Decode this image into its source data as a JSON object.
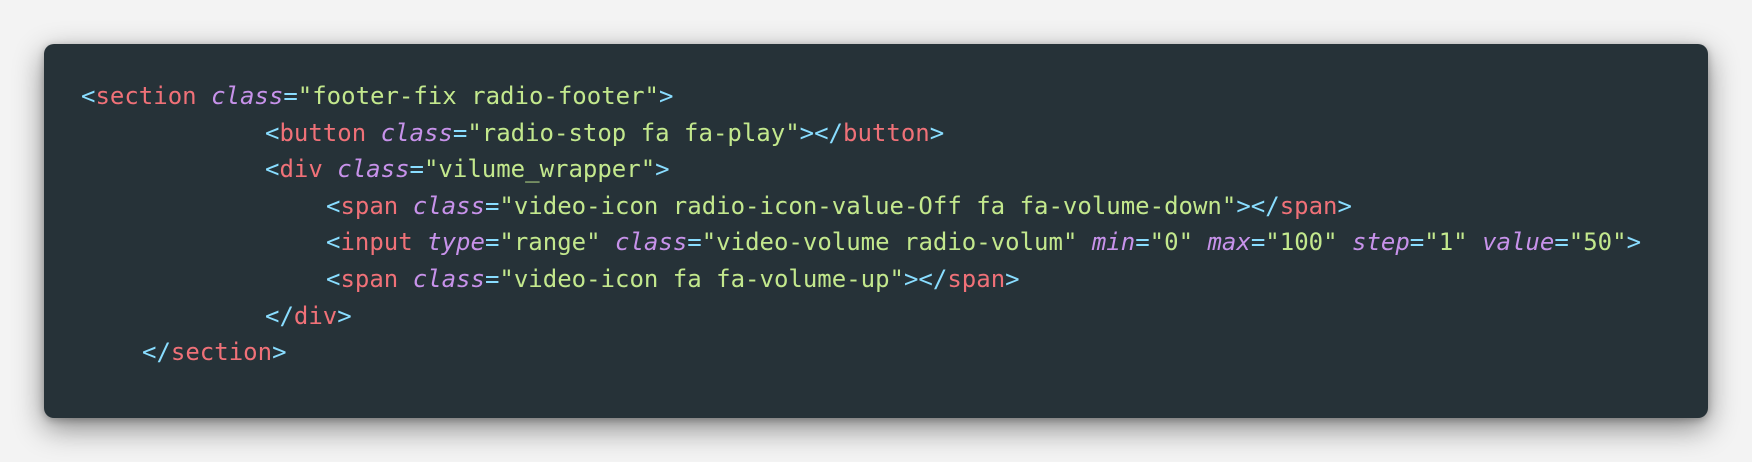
{
  "colors": {
    "background": "#f3f3f3",
    "panel": "#263238",
    "punctuation": "#89ddff",
    "tag": "#f07178",
    "attribute": "#c792ea",
    "string": "#c3e88d"
  },
  "code": {
    "lines": [
      {
        "indent": 0,
        "tokens": [
          {
            "t": "punct",
            "v": "<"
          },
          {
            "t": "tag",
            "v": "section"
          },
          {
            "t": "space",
            "v": " "
          },
          {
            "t": "attr",
            "v": "class"
          },
          {
            "t": "eq",
            "v": "="
          },
          {
            "t": "str",
            "v": "\"footer-fix radio-footer\""
          },
          {
            "t": "punct",
            "v": ">"
          }
        ]
      },
      {
        "indent": 2,
        "tokens": [
          {
            "t": "punct",
            "v": "<"
          },
          {
            "t": "tag",
            "v": "button"
          },
          {
            "t": "space",
            "v": " "
          },
          {
            "t": "attr",
            "v": "class"
          },
          {
            "t": "eq",
            "v": "="
          },
          {
            "t": "str",
            "v": "\"radio-stop fa fa-play\""
          },
          {
            "t": "punct",
            "v": "></"
          },
          {
            "t": "tag",
            "v": "button"
          },
          {
            "t": "punct",
            "v": ">"
          }
        ]
      },
      {
        "indent": 2,
        "tokens": [
          {
            "t": "punct",
            "v": "<"
          },
          {
            "t": "tag",
            "v": "div"
          },
          {
            "t": "space",
            "v": " "
          },
          {
            "t": "attr",
            "v": "class"
          },
          {
            "t": "eq",
            "v": "="
          },
          {
            "t": "str",
            "v": "\"vilume_wrapper\""
          },
          {
            "t": "punct",
            "v": ">"
          }
        ]
      },
      {
        "indent": 3,
        "tokens": [
          {
            "t": "punct",
            "v": "<"
          },
          {
            "t": "tag",
            "v": "span"
          },
          {
            "t": "space",
            "v": " "
          },
          {
            "t": "attr",
            "v": "class"
          },
          {
            "t": "eq",
            "v": "="
          },
          {
            "t": "str",
            "v": "\"video-icon radio-icon-value-Off fa fa-volume-down\""
          },
          {
            "t": "punct",
            "v": "></"
          },
          {
            "t": "tag",
            "v": "span"
          },
          {
            "t": "punct",
            "v": ">"
          }
        ]
      },
      {
        "indent": 3,
        "tokens": [
          {
            "t": "punct",
            "v": "<"
          },
          {
            "t": "tag",
            "v": "input"
          },
          {
            "t": "space",
            "v": " "
          },
          {
            "t": "attr",
            "v": "type"
          },
          {
            "t": "eq",
            "v": "="
          },
          {
            "t": "str",
            "v": "\"range\""
          },
          {
            "t": "space",
            "v": " "
          },
          {
            "t": "attr",
            "v": "class"
          },
          {
            "t": "eq",
            "v": "="
          },
          {
            "t": "str",
            "v": "\"video-volume radio-volum\""
          },
          {
            "t": "space",
            "v": " "
          },
          {
            "t": "attr",
            "v": "min"
          },
          {
            "t": "eq",
            "v": "="
          },
          {
            "t": "str",
            "v": "\"0\""
          },
          {
            "t": "space",
            "v": " "
          },
          {
            "t": "attr",
            "v": "max"
          },
          {
            "t": "eq",
            "v": "="
          },
          {
            "t": "str",
            "v": "\"100\""
          },
          {
            "t": "space",
            "v": " "
          },
          {
            "t": "attr",
            "v": "step"
          },
          {
            "t": "eq",
            "v": "="
          },
          {
            "t": "str",
            "v": "\"1\""
          },
          {
            "t": "space",
            "v": " "
          },
          {
            "t": "attr",
            "v": "value"
          },
          {
            "t": "eq",
            "v": "="
          },
          {
            "t": "str",
            "v": "\"50\""
          },
          {
            "t": "punct",
            "v": ">"
          }
        ]
      },
      {
        "indent": 3,
        "tokens": [
          {
            "t": "punct",
            "v": "<"
          },
          {
            "t": "tag",
            "v": "span"
          },
          {
            "t": "space",
            "v": " "
          },
          {
            "t": "attr",
            "v": "class"
          },
          {
            "t": "eq",
            "v": "="
          },
          {
            "t": "str",
            "v": "\"video-icon fa fa-volume-up\""
          },
          {
            "t": "punct",
            "v": "></"
          },
          {
            "t": "tag",
            "v": "span"
          },
          {
            "t": "punct",
            "v": ">"
          }
        ]
      },
      {
        "indent": 2,
        "tokens": [
          {
            "t": "punct",
            "v": "</"
          },
          {
            "t": "tag",
            "v": "div"
          },
          {
            "t": "punct",
            "v": ">"
          }
        ]
      },
      {
        "indent": 1,
        "tokens": [
          {
            "t": "punct",
            "v": "</"
          },
          {
            "t": "tag",
            "v": "section"
          },
          {
            "t": "punct",
            "v": ">"
          }
        ]
      }
    ]
  }
}
